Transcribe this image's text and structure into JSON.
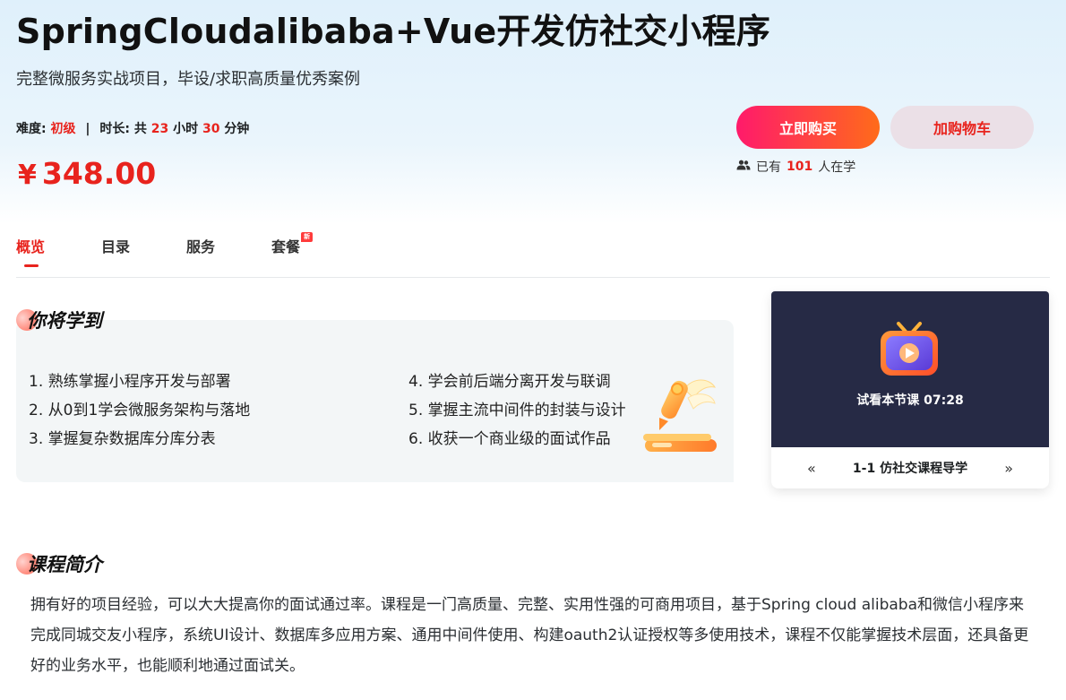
{
  "course": {
    "title": "SpringCloudalibaba+Vue开发仿社交小程序",
    "subtitle": "完整微服务实战项目，毕设/求职高质量优秀案例"
  },
  "meta": {
    "difficulty_label": "难度:",
    "difficulty_value": "初级",
    "separator": "|",
    "duration_label": "时长:",
    "duration_prefix": "共",
    "hours": "23",
    "hours_unit": "小时",
    "minutes": "30",
    "minutes_unit": "分钟"
  },
  "price": {
    "currency": "¥",
    "amount": "348.00"
  },
  "actions": {
    "buy_label": "立即购买",
    "cart_label": "加购物车"
  },
  "learners": {
    "prefix": "已有",
    "count": "101",
    "suffix": "人在学"
  },
  "tabs": [
    {
      "label": "概览",
      "active": true
    },
    {
      "label": "目录",
      "active": false
    },
    {
      "label": "服务",
      "active": false
    },
    {
      "label": "套餐",
      "active": false,
      "badge": "新"
    }
  ],
  "learn": {
    "heading": "你将学到",
    "items_left": [
      "1. 熟练掌握小程序开发与部署",
      "2. 从0到1学会微服务架构与落地",
      "3. 掌握复杂数据库分库分表"
    ],
    "items_right": [
      "4. 学会前后端分离开发与联调",
      "5. 掌握主流中间件的封装与设计",
      "6. 收获一个商业级的面试作品"
    ]
  },
  "video": {
    "trial_label": "试看本节课",
    "trial_duration": "07:28",
    "lesson_title": "1-1 仿社交课程导学",
    "prev_icon": "«",
    "next_icon": "»"
  },
  "intro": {
    "heading": "课程简介",
    "text": "拥有好的项目经验，可以大大提高你的面试通过率。课程是一门高质量、完整、实用性强的可商用项目，基于Spring cloud alibaba和微信小程序来完成同城交友小程序，系统UI设计、数据库多应用方案、通用中间件使用、构建oauth2认证授权等多使用技术，课程不仅能掌握技术层面，还具备更好的业务水平，也能顺利地通过面试关。"
  },
  "colors": {
    "accent_red": "#e8231d",
    "buy_gradient_start": "#ff1a6b",
    "buy_gradient_end": "#ff6b1a",
    "cart_bg": "#ebe0e7",
    "video_bg": "#262a45"
  },
  "icons": {
    "learners": "users-icon",
    "video": "tv-play-icon",
    "learn_illustration": "pen-book-illustration"
  }
}
